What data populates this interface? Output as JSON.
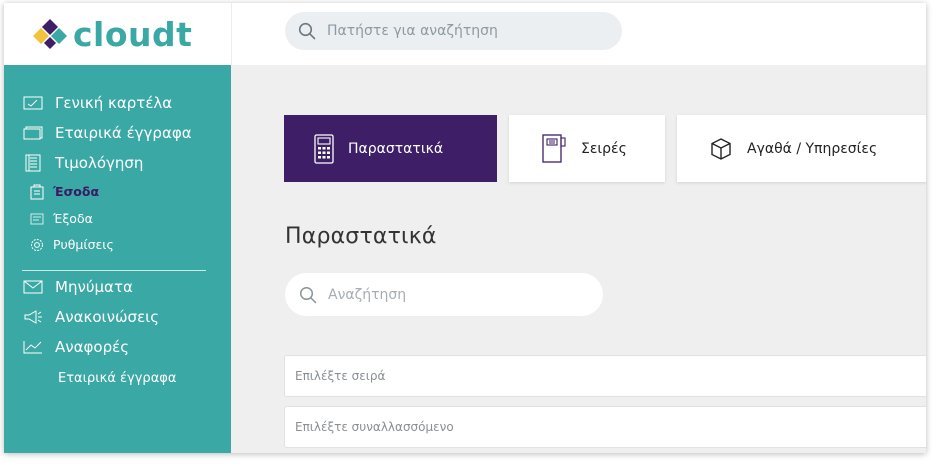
{
  "brand": {
    "name": "cloudt",
    "color": "#3aa8a4"
  },
  "header": {
    "search_placeholder": "Πατήστε για αναζήτηση"
  },
  "sidebar": {
    "items": [
      {
        "label": "Γενική καρτέλα",
        "icon": "dashboard-icon"
      },
      {
        "label": "Εταιρικά έγγραφα",
        "icon": "documents-icon"
      },
      {
        "label": "Τιμολόγηση",
        "icon": "invoice-icon"
      }
    ],
    "sub_items": [
      {
        "label": "Έσοδα",
        "icon": "income-icon",
        "active": true
      },
      {
        "label": "Έξοδα",
        "icon": "expenses-icon",
        "active": false
      },
      {
        "label": "Ρυθμίσεις",
        "icon": "settings-gear-icon",
        "active": false
      }
    ],
    "items_after_divider": [
      {
        "label": "Μηνύματα",
        "icon": "envelope-icon"
      },
      {
        "label": "Ανακοινώσεις",
        "icon": "megaphone-icon"
      },
      {
        "label": "Αναφορές",
        "icon": "chart-icon"
      }
    ],
    "extra_link": "Εταιρικά έγγραφα"
  },
  "tabs": [
    {
      "label": "Παραστατικά",
      "icon": "calculator-icon",
      "active": true
    },
    {
      "label": "Σειρές",
      "icon": "notebook-icon",
      "active": false
    },
    {
      "label": "Αγαθά / Υπηρεσίες",
      "icon": "box-icon",
      "active": false
    }
  ],
  "content": {
    "title": "Παραστατικά",
    "search_placeholder": "Αναζήτηση",
    "series_select_placeholder": "Επιλέξτε σειρά",
    "party_select_placeholder": "Επιλέξτε συναλλασσόμενο"
  },
  "colors": {
    "sidebar_bg": "#3aa8a4",
    "active_tab_bg": "#3e1f67",
    "active_sub_item": "#3b1a63",
    "logo_diamond_purple": "#3e1f67",
    "logo_diamond_yellow": "#f2c33c",
    "logo_diamond_green": "#3aa8a4"
  }
}
